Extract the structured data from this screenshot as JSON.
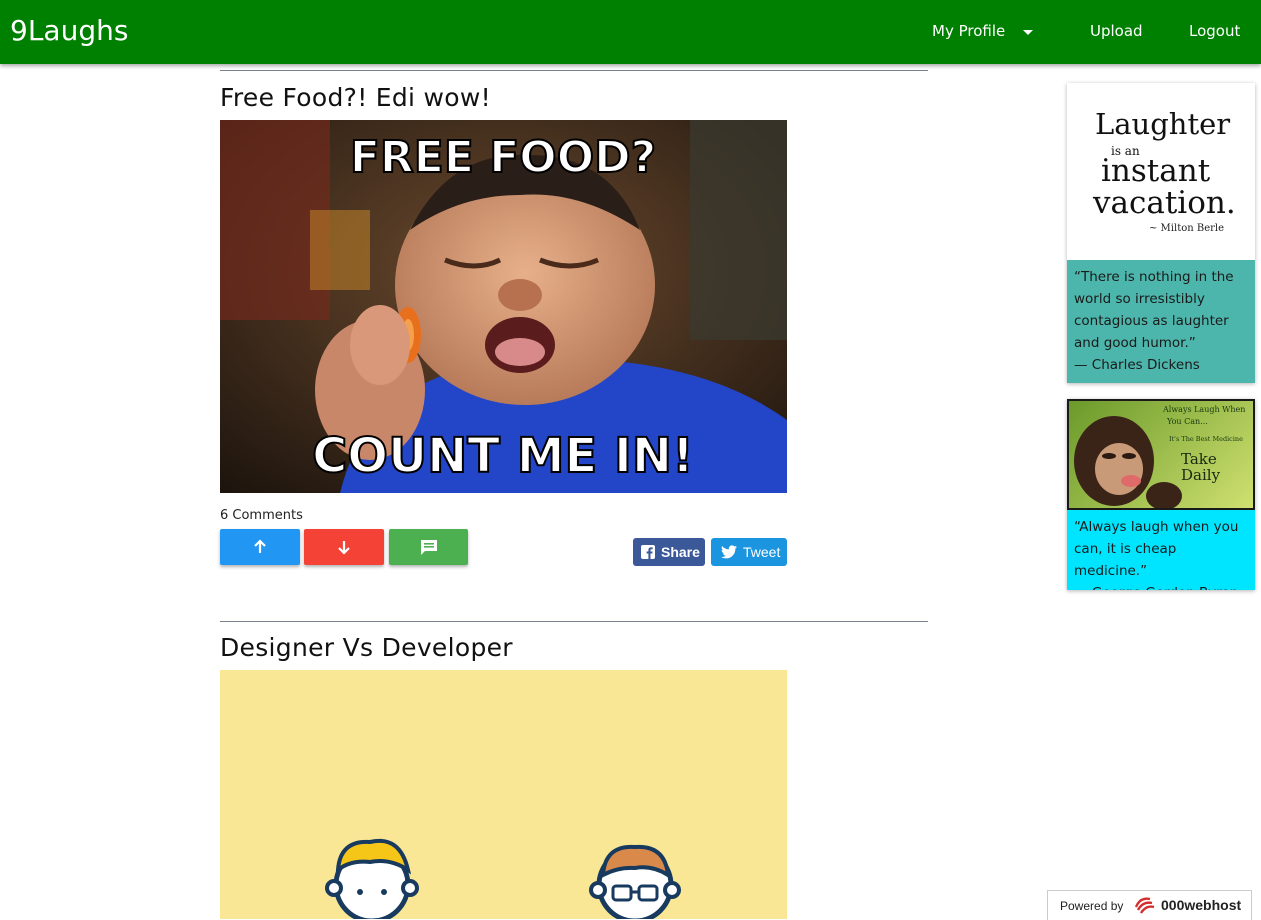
{
  "navbar": {
    "brand": "9Laughs",
    "my_profile": "My Profile",
    "upload": "Upload",
    "logout": "Logout",
    "color": "#008000"
  },
  "posts": [
    {
      "title": "Free Food?! Edi wow!",
      "image_top_text": "FREE FOOD?",
      "image_bottom_text": "COUNT ME IN!",
      "comments": "6 Comments",
      "upvote_icon": "arrow-up-icon",
      "downvote_icon": "arrow-down-icon",
      "comment_icon": "comment-icon",
      "share_label": "Share",
      "tweet_label": "Tweet"
    },
    {
      "title": "Designer Vs Developer"
    }
  ],
  "sidebar": {
    "cards": [
      {
        "image_text_big1": "Laughter",
        "image_text_small": "is an",
        "image_text_big2": "instant",
        "image_text_big3": "vacation.",
        "image_author": "~ Milton Berle",
        "quote": "“There is nothing in the world so irresistibly contagious as laughter and good humor.”",
        "author": "— Charles Dickens",
        "color": "#4db6ac"
      },
      {
        "image_text_line1": "Always Laugh When",
        "image_text_line2": "You Can...",
        "image_text_line3": "It's The Best Medicine",
        "image_text_line4": "Take Daily",
        "quote": "“Always laugh when you can, it is cheap medicine.”",
        "author": "— George Gordon Byron",
        "color": "#00e5ff"
      }
    ]
  },
  "footer_badge": {
    "powered_by": "Powered by",
    "host": "000webhost"
  },
  "colors": {
    "upvote": "#2196f3",
    "downvote": "#f44336",
    "comment": "#4caf50",
    "facebook": "#3b5998",
    "twitter": "#1b95e0"
  }
}
